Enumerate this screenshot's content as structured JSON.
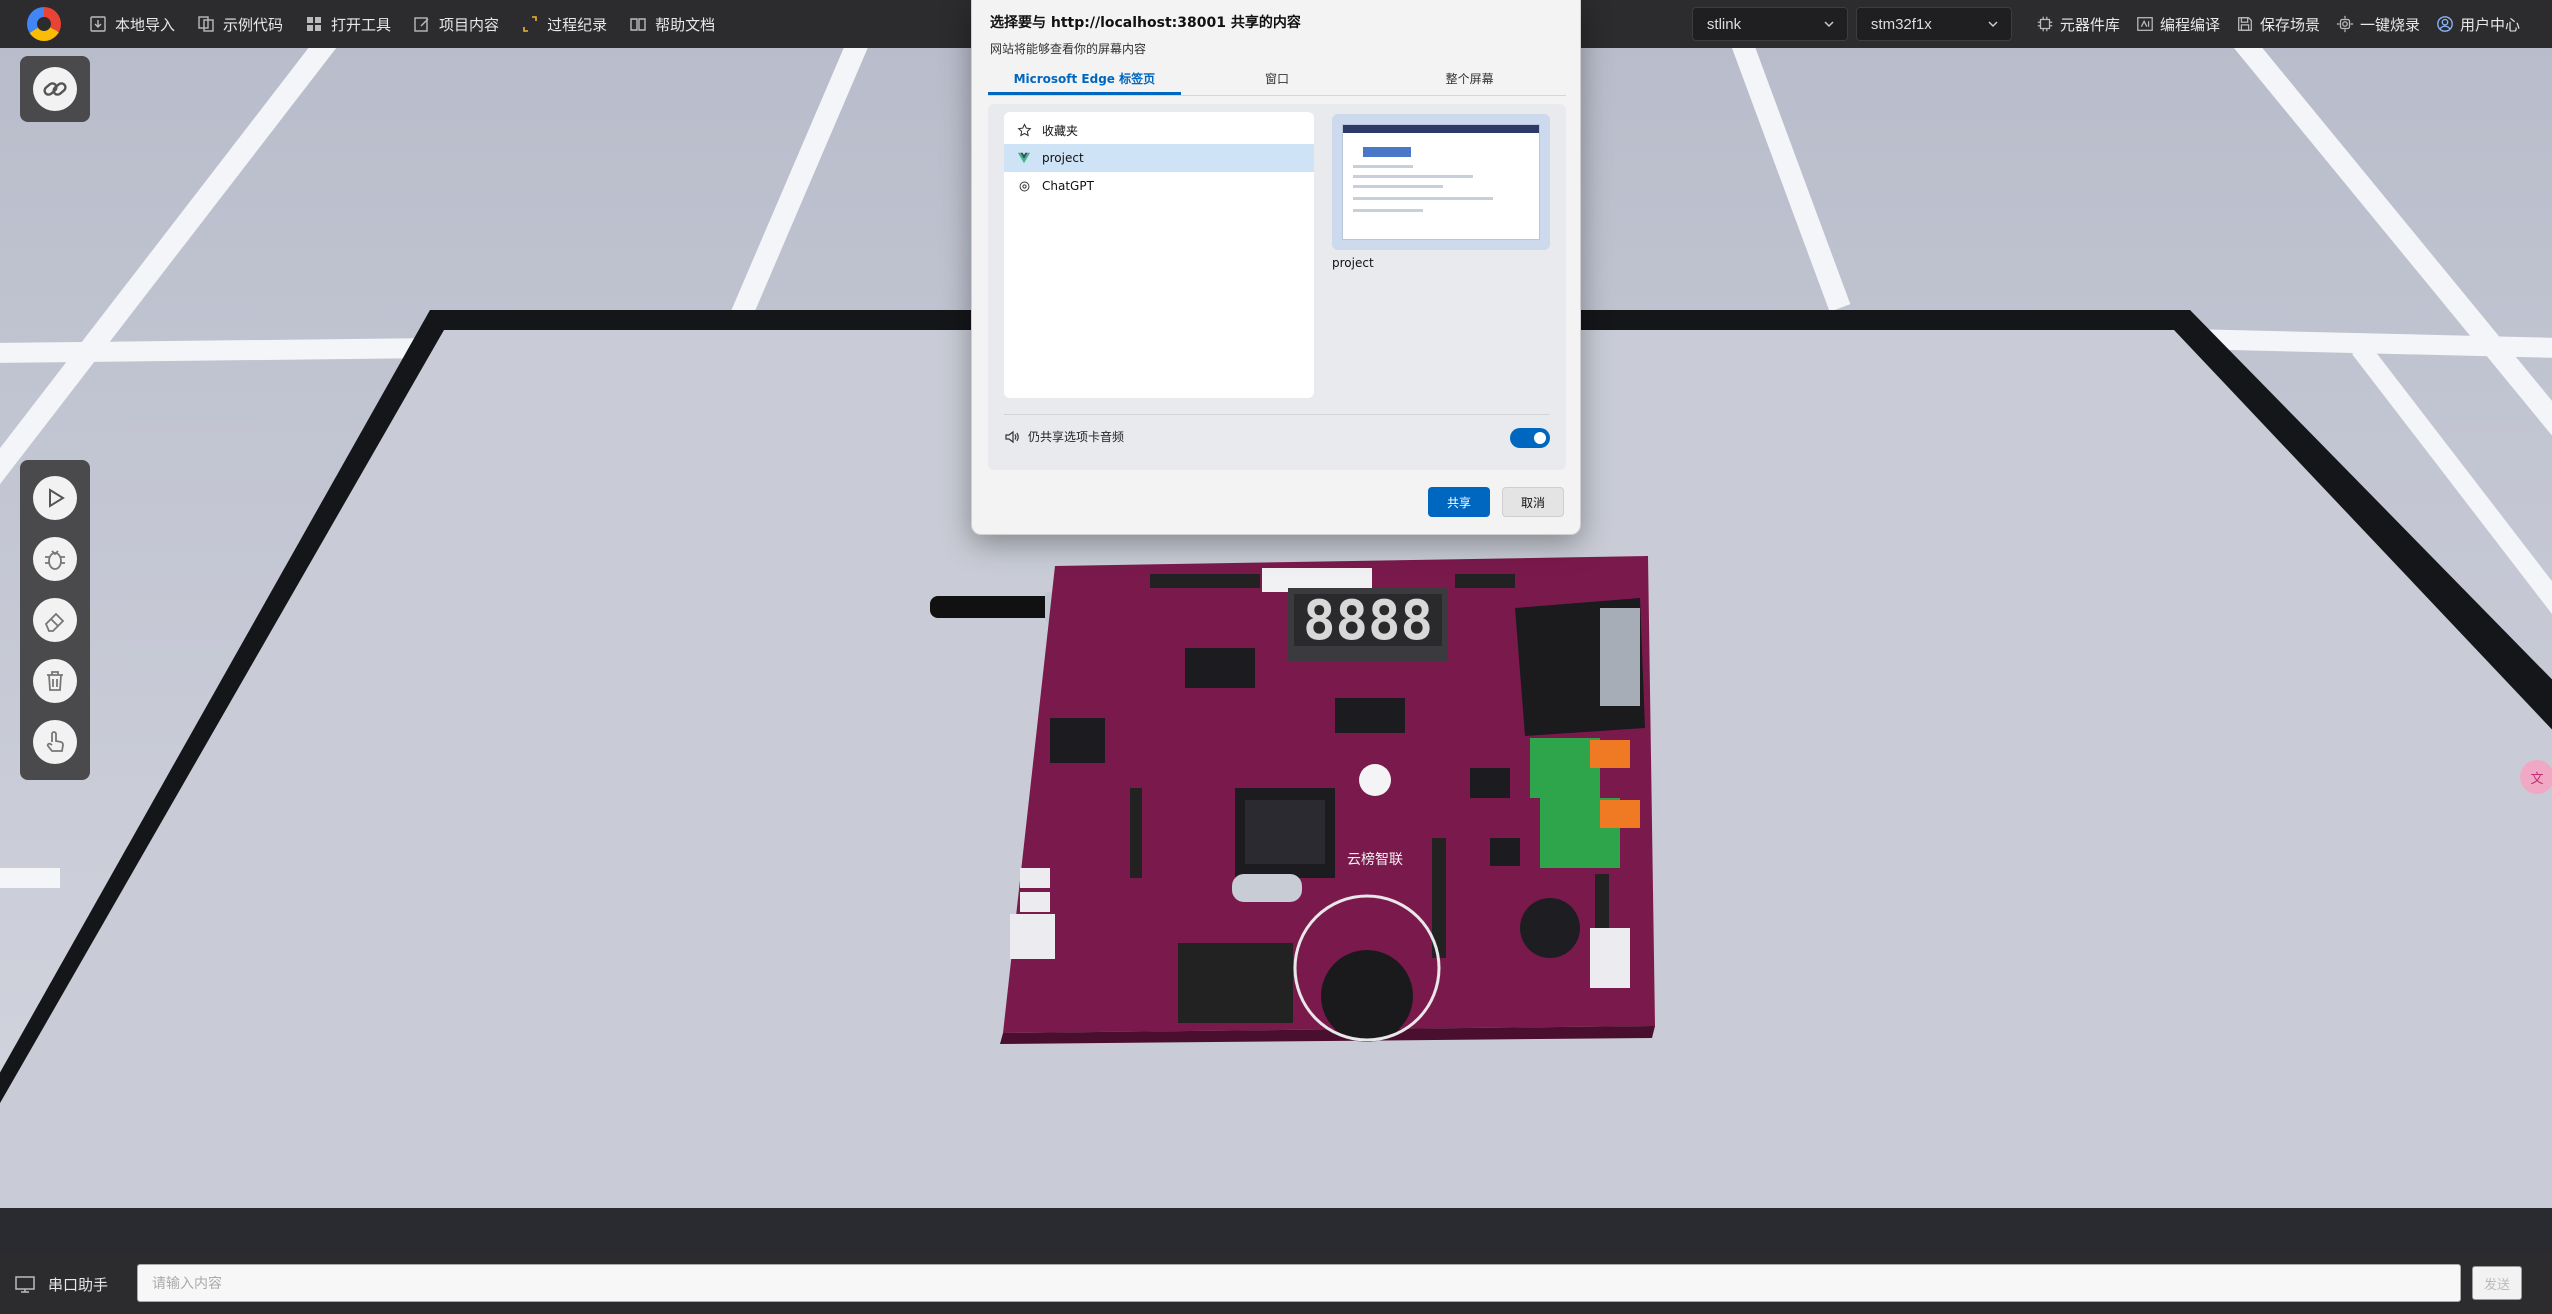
{
  "topbar": {
    "nav": [
      {
        "label": "本地导入",
        "icon": "import-icon"
      },
      {
        "label": "示例代码",
        "icon": "code-copy-icon"
      },
      {
        "label": "打开工具",
        "icon": "grid-icon"
      },
      {
        "label": "项目内容",
        "icon": "edit-icon"
      },
      {
        "label": "过程纪录",
        "icon": "record-icon"
      },
      {
        "label": "帮助文档",
        "icon": "book-icon"
      }
    ],
    "programmer_select": "stlink",
    "chip_select": "stm32f1x",
    "tools": [
      {
        "label": "元器件库",
        "icon": "chip-icon"
      },
      {
        "label": "编程编译",
        "icon": "compile-icon"
      },
      {
        "label": "保存场景",
        "icon": "save-icon"
      },
      {
        "label": "一键烧录",
        "icon": "gear-icon"
      },
      {
        "label": "用户中心",
        "icon": "user-icon"
      }
    ]
  },
  "dialog": {
    "title": "选择要与 http://localhost:38001 共享的内容",
    "subtitle": "网站将能够查看你的屏幕内容",
    "tabs": [
      "Microsoft Edge 标签页",
      "窗口",
      "整个屏幕"
    ],
    "active_tab": 0,
    "items": [
      {
        "label": "收藏夹",
        "icon": "star-icon"
      },
      {
        "label": "project",
        "icon": "vue-icon"
      },
      {
        "label": "ChatGPT",
        "icon": "chatgpt-icon"
      }
    ],
    "selected_item": 1,
    "preview_label": "project",
    "audio_label": "仍共享选项卡音频",
    "audio_enabled": true,
    "share_label": "共享",
    "cancel_label": "取消"
  },
  "board": {
    "display_text": "8888",
    "brand_text": "云榜智联"
  },
  "bottombar": {
    "serial_label": "串口助手",
    "input_placeholder": "请输入内容",
    "send_label": "发送"
  },
  "colors": {
    "topbar_bg": "#2c2c2e",
    "accent": "#0067c0",
    "pcb": "#7a1a4c",
    "floor": "#c9ccd6"
  }
}
